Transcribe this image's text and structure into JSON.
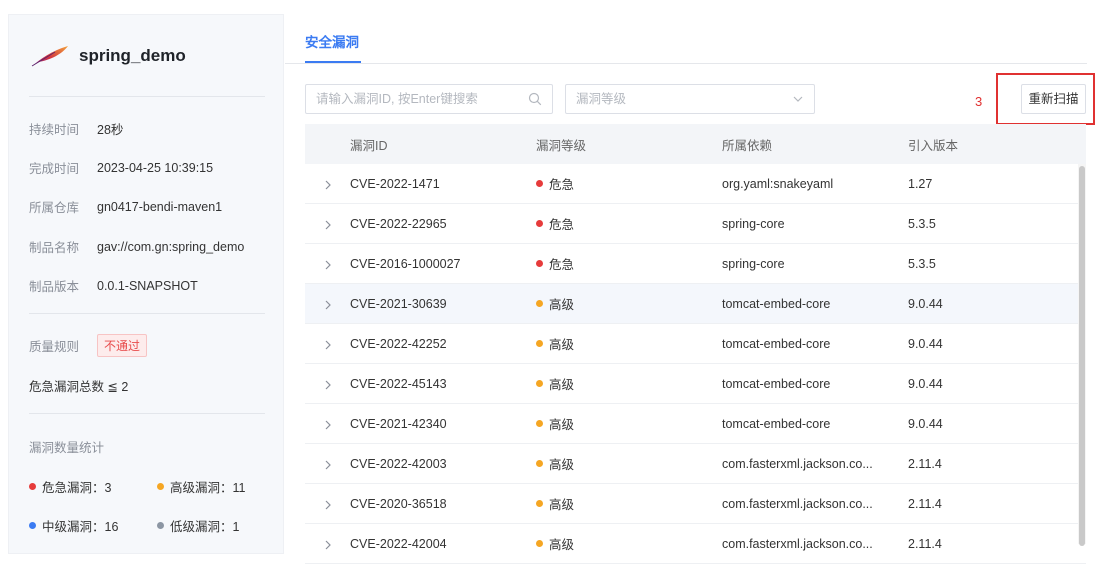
{
  "project": {
    "name": "spring_demo"
  },
  "info": [
    {
      "label": "持续时间",
      "value": "28秒"
    },
    {
      "label": "完成时间",
      "value": "2023-04-25 10:39:15"
    },
    {
      "label": "所属仓库",
      "value": "gn0417-bendi-maven1"
    },
    {
      "label": "制品名称",
      "value": "gav://com.gn:spring_demo"
    },
    {
      "label": "制品版本",
      "value": "0.0.1-SNAPSHOT"
    }
  ],
  "quality": {
    "label": "质量规则",
    "status": "不通过",
    "rule": "危急漏洞总数 ≦ 2"
  },
  "stats": {
    "title": "漏洞数量统计",
    "critical": "危急漏洞：3",
    "high": "高级漏洞：11",
    "medium": "中级漏洞：16",
    "low": "低级漏洞：1"
  },
  "colors": {
    "critical": "#e63b3b",
    "high": "#f5a623",
    "medium": "#3b7bf2",
    "low": "#8c96a3",
    "accent": "#3b7bf2"
  },
  "tabs": {
    "active": "安全漏洞"
  },
  "search": {
    "placeholder": "请输入漏洞ID, 按Enter键搜索"
  },
  "level_select": {
    "placeholder": "漏洞等级"
  },
  "annotation": {
    "number": "3"
  },
  "toolbar": {
    "rescan_label": "重新扫描"
  },
  "table": {
    "headers": {
      "id": "漏洞ID",
      "level": "漏洞等级",
      "dependency": "所属依赖",
      "version": "引入版本"
    },
    "rows": [
      {
        "id": "CVE-2022-1471",
        "level": "危急",
        "severity": "critical",
        "dependency": "org.yaml:snakeyaml",
        "version": "1.27"
      },
      {
        "id": "CVE-2022-22965",
        "level": "危急",
        "severity": "critical",
        "dependency": "spring-core",
        "version": "5.3.5"
      },
      {
        "id": "CVE-2016-1000027",
        "level": "危急",
        "severity": "critical",
        "dependency": "spring-core",
        "version": "5.3.5"
      },
      {
        "id": "CVE-2021-30639",
        "level": "高级",
        "severity": "high",
        "dependency": "tomcat-embed-core",
        "version": "9.0.44"
      },
      {
        "id": "CVE-2022-42252",
        "level": "高级",
        "severity": "high",
        "dependency": "tomcat-embed-core",
        "version": "9.0.44"
      },
      {
        "id": "CVE-2022-45143",
        "level": "高级",
        "severity": "high",
        "dependency": "tomcat-embed-core",
        "version": "9.0.44"
      },
      {
        "id": "CVE-2021-42340",
        "level": "高级",
        "severity": "high",
        "dependency": "tomcat-embed-core",
        "version": "9.0.44"
      },
      {
        "id": "CVE-2022-42003",
        "level": "高级",
        "severity": "high",
        "dependency": "com.fasterxml.jackson.co...",
        "version": "2.11.4"
      },
      {
        "id": "CVE-2020-36518",
        "level": "高级",
        "severity": "high",
        "dependency": "com.fasterxml.jackson.co...",
        "version": "2.11.4"
      },
      {
        "id": "CVE-2022-42004",
        "level": "高级",
        "severity": "high",
        "dependency": "com.fasterxml.jackson.co...",
        "version": "2.11.4"
      }
    ]
  }
}
